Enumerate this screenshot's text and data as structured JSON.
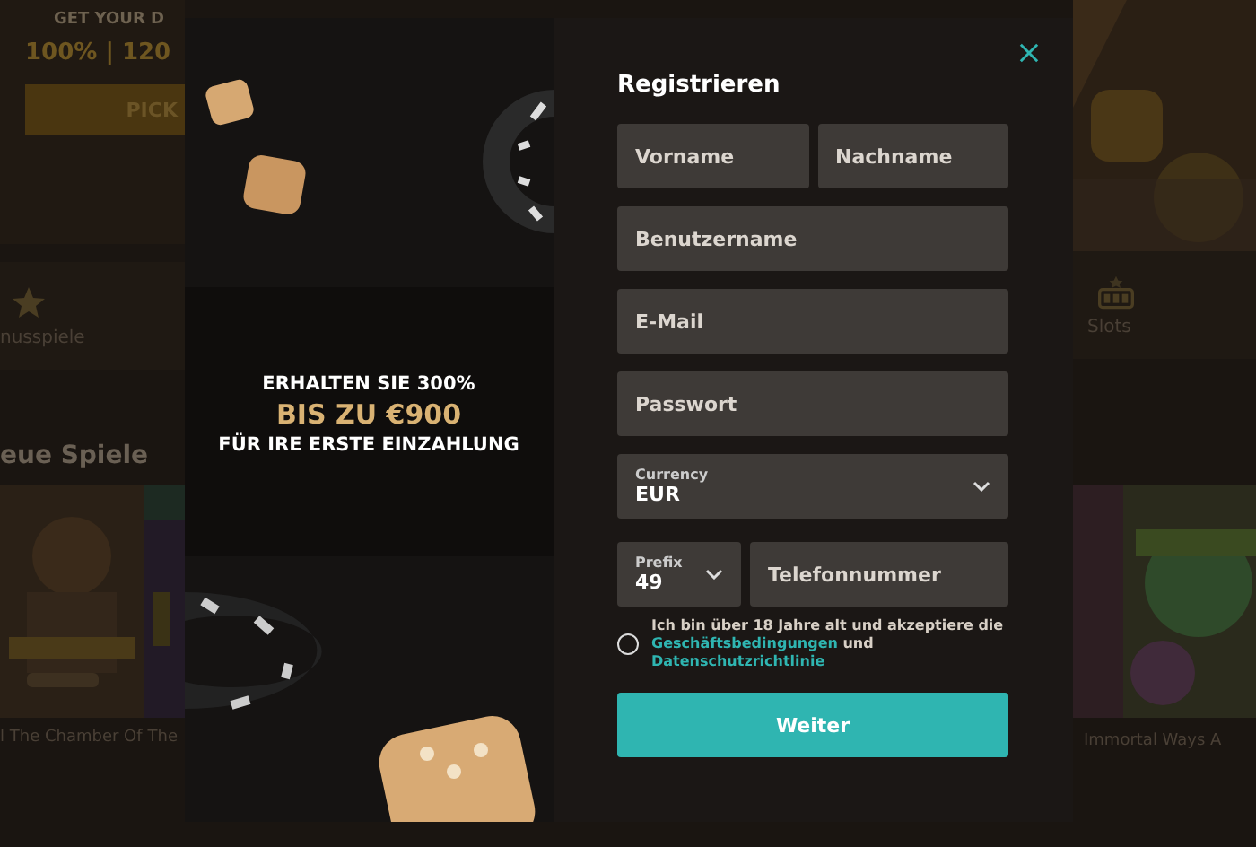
{
  "background": {
    "banner": {
      "heading": "GET YOUR D",
      "offer": "100% | 120",
      "button": "PICK"
    },
    "categories": [
      {
        "label": "nusspiele"
      },
      {
        "label": "Slots"
      }
    ],
    "section_title": "eue Spiele",
    "games": [
      {
        "title": "l The Chamber Of"
      },
      {
        "title": "The"
      },
      {
        "title": "Immortal Ways A"
      }
    ]
  },
  "promo": {
    "line_1": "ERHALTEN SIE 300%",
    "line_2": "BIS ZU €900",
    "line_3": "FÜR IRE ERSTE EINZAHLUNG"
  },
  "form": {
    "title": "Registrieren",
    "first_name": {
      "placeholder": "Vorname"
    },
    "last_name": {
      "placeholder": "Nachname"
    },
    "username": {
      "placeholder": "Benutzername"
    },
    "email": {
      "placeholder": "E-Mail"
    },
    "password": {
      "placeholder": "Passwort"
    },
    "currency": {
      "label": "Currency",
      "value": "EUR"
    },
    "prefix": {
      "label": "Prefix",
      "value": "49"
    },
    "phone": {
      "placeholder": "Telefonnummer"
    },
    "consent": {
      "checked": false,
      "text": "Ich bin über 18 Jahre alt und akzeptiere die",
      "link_1": "Geschäftsbedingungen",
      "joiner": "und",
      "link_2": "Datenschutzrichtlinie"
    },
    "submit": "Weiter"
  }
}
